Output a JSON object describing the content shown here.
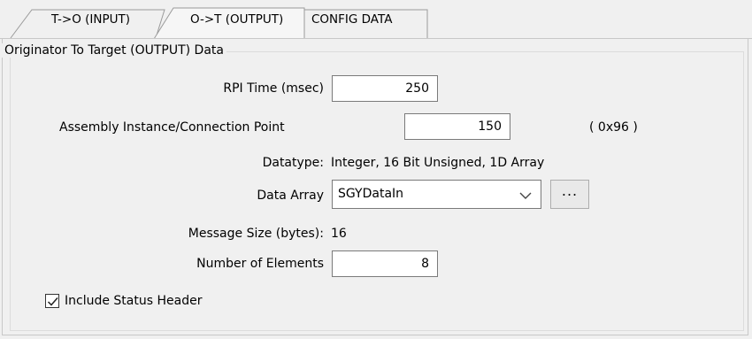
{
  "tabs": [
    {
      "label": "T->O (INPUT)"
    },
    {
      "label": "O->T (OUTPUT)"
    },
    {
      "label": "CONFIG DATA"
    }
  ],
  "active_tab": "O->T (OUTPUT)",
  "group": {
    "title": "Originator To Target (OUTPUT) Data"
  },
  "rpi": {
    "label": "RPI Time (msec)",
    "value": "250"
  },
  "assembly": {
    "label": "Assembly Instance/Connection Point",
    "value": "150",
    "hex": "( 0x96 )"
  },
  "datatype": {
    "label": "Datatype:",
    "value": "Integer, 16 Bit Unsigned, 1D Array"
  },
  "data_array": {
    "label": "Data Array",
    "value": "SGYDataIn",
    "browse_label": "..."
  },
  "message_size": {
    "label": "Message Size (bytes):",
    "value": "16"
  },
  "num_elements": {
    "label": "Number of Elements",
    "value": "8"
  },
  "status_header": {
    "label": "Include Status Header",
    "checked": true
  },
  "icons": {
    "dropdown": "chevron-down-icon",
    "check": "checkmark-icon"
  }
}
